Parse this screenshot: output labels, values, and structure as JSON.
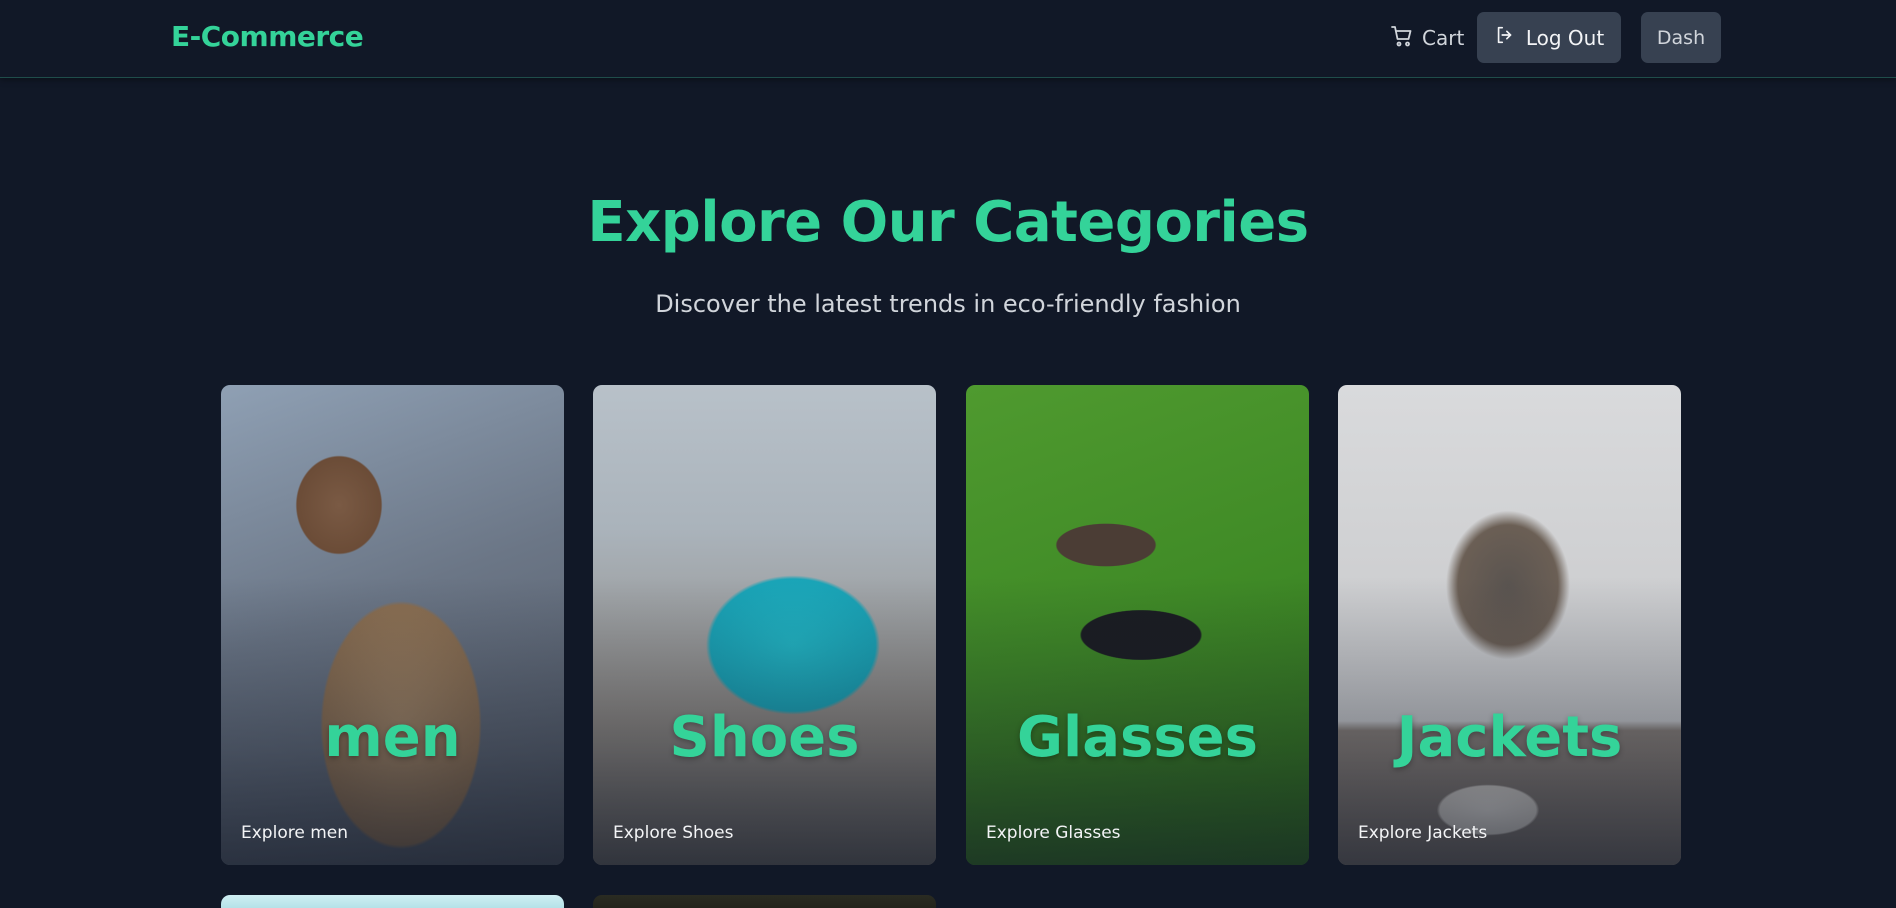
{
  "header": {
    "brand": "E-Commerce",
    "cart_label": "Cart",
    "logout_label": "Log Out",
    "dash_label": "Dash"
  },
  "hero": {
    "title": "Explore Our Categories",
    "subtitle": "Discover the latest trends in eco-friendly fashion"
  },
  "categories": [
    {
      "name": "men",
      "explore": "Explore men"
    },
    {
      "name": "Shoes",
      "explore": "Explore Shoes"
    },
    {
      "name": "Glasses",
      "explore": "Explore Glasses"
    },
    {
      "name": "Jackets",
      "explore": "Explore Jackets"
    }
  ],
  "colors": {
    "background": "#111827",
    "accent": "#34d399",
    "button_bg": "#374151"
  },
  "icons": {
    "cart": "shopping-cart-icon",
    "logout": "logout-icon"
  }
}
